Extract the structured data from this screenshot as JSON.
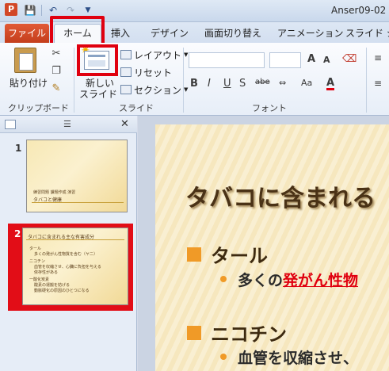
{
  "app": {
    "icon_letter": "P",
    "window_title": "Anser09-02"
  },
  "qat": {
    "save_icon": "save-icon",
    "undo_icon": "undo-icon",
    "redo_icon": "redo-icon"
  },
  "tabs": {
    "file": "ファイル",
    "home": "ホーム",
    "insert": "挿入",
    "design": "デザイン",
    "transitions": "画面切り替え",
    "animations": "アニメーション",
    "slideshow": "スライド ショ"
  },
  "ribbon": {
    "clipboard": {
      "paste_label": "貼り付け",
      "group_label": "クリップボード"
    },
    "slides": {
      "new_slide_line1": "新しい",
      "new_slide_line2": "スライド",
      "layout_label": "レイアウト",
      "reset_label": "リセット",
      "section_label": "セクション",
      "group_label": "スライド"
    },
    "font": {
      "group_label": "フォント",
      "bold": "B",
      "italic": "I",
      "underline": "U",
      "shadow": "S",
      "strike": "abe",
      "grow": "A",
      "shrink": "A"
    }
  },
  "panel": {
    "slides": [
      {
        "number": "1",
        "title_line1": "練習問題 課題作成 演習",
        "title_line2": "タバコと健康"
      },
      {
        "number": "2",
        "title": "タバコに含まれる主な有害成分",
        "lines": [
          "タール",
          "多くの発がん性物質を含む（ヤニ）",
          "ニコチン",
          "血管を収縮させ、心臓に負担を与える",
          "依存性がある",
          "一酸化炭素",
          "酸素の運搬を妨げる",
          "動脈硬化の原因のひとつになる"
        ]
      }
    ]
  },
  "slide": {
    "title": "タバコに含まれる",
    "bullet1": "タール",
    "sub1_prefix": "多くの",
    "sub1_red": "発がん性物",
    "bullet2": "ニコチン",
    "sub2": "血管を収縮させ、"
  },
  "colors": {
    "highlight": "#e0000f",
    "file_tab": "#d24726",
    "bullet": "#f09a27"
  }
}
